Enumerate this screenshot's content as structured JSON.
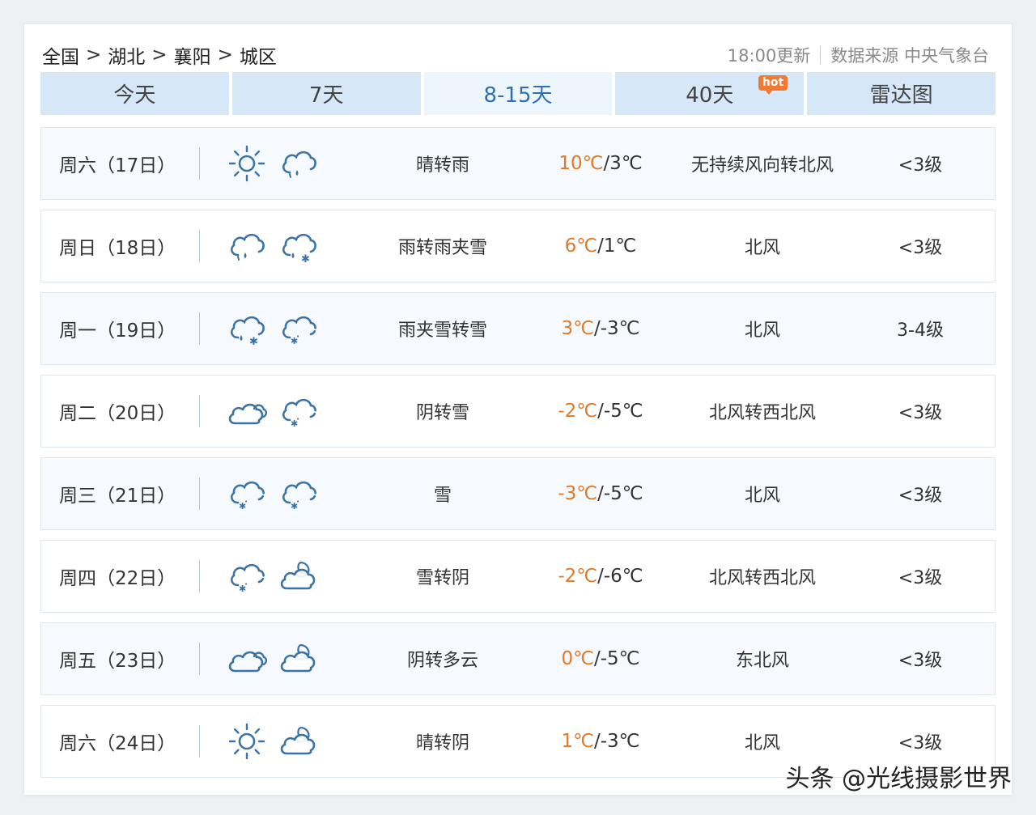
{
  "breadcrumb": [
    "全国",
    "湖北",
    "襄阳",
    "城区"
  ],
  "breadcrumb_sep": ">",
  "update_time": "18:00更新",
  "data_source": "数据来源 中央气象台",
  "tabs": [
    {
      "label": "今天",
      "active": false
    },
    {
      "label": "7天",
      "active": false
    },
    {
      "label": "8-15天",
      "active": true
    },
    {
      "label": "40天",
      "active": false,
      "badge": "hot"
    },
    {
      "label": "雷达图",
      "active": false
    }
  ],
  "days": [
    {
      "day": "周六（17日）",
      "icons": [
        "sun",
        "cloud-rain"
      ],
      "desc": "晴转雨",
      "hi": "10℃",
      "lo": "/3℃",
      "wind": "无持续风向转北风",
      "level": "<3级"
    },
    {
      "day": "周日（18日）",
      "icons": [
        "cloud-rain",
        "cloud-sleet"
      ],
      "desc": "雨转雨夹雪",
      "hi": "6℃",
      "lo": "/1℃",
      "wind": "北风",
      "level": "<3级"
    },
    {
      "day": "周一（19日）",
      "icons": [
        "cloud-sleet",
        "cloud-snow"
      ],
      "desc": "雨夹雪转雪",
      "hi": "3℃",
      "lo": "/-3℃",
      "wind": "北风",
      "level": "3-4级"
    },
    {
      "day": "周二（20日）",
      "icons": [
        "overcast",
        "cloud-snow"
      ],
      "desc": "阴转雪",
      "hi": "-2℃",
      "lo": "/-5℃",
      "wind": "北风转西北风",
      "level": "<3级"
    },
    {
      "day": "周三（21日）",
      "icons": [
        "cloud-snow",
        "cloud-snow"
      ],
      "desc": "雪",
      "hi": "-3℃",
      "lo": "/-5℃",
      "wind": "北风",
      "level": "<3级"
    },
    {
      "day": "周四（22日）",
      "icons": [
        "cloud-snow",
        "moon-cloud"
      ],
      "desc": "雪转阴",
      "hi": "-2℃",
      "lo": "/-6℃",
      "wind": "北风转西北风",
      "level": "<3级"
    },
    {
      "day": "周五（23日）",
      "icons": [
        "overcast",
        "moon-cloud"
      ],
      "desc": "阴转多云",
      "hi": "0℃",
      "lo": "/-5℃",
      "wind": "东北风",
      "level": "<3级"
    },
    {
      "day": "周六（24日）",
      "icons": [
        "sun",
        "moon-cloud"
      ],
      "desc": "晴转阴",
      "hi": "1℃",
      "lo": "/-3℃",
      "wind": "北风",
      "level": "<3级"
    }
  ],
  "watermark": "头条 @光线摄影世界",
  "colors": {
    "accent": "#2c6fb5",
    "tab_bg": "#d6e7f8",
    "hi_temp": "#e07a2a",
    "icon": "#3a73a8",
    "hot_badge": "#f07a2f"
  }
}
